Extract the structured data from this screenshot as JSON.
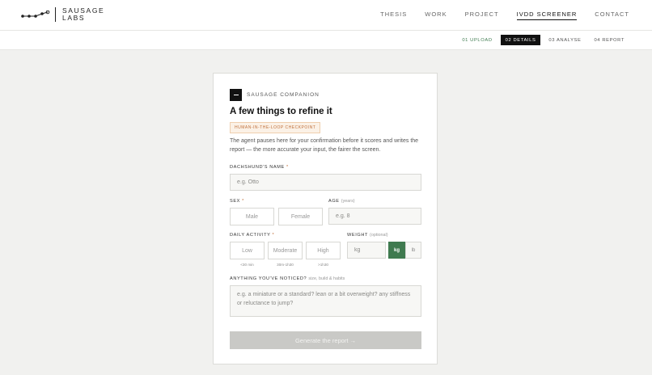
{
  "brand": {
    "line1": "SAUSAGE",
    "line2": "LABS"
  },
  "nav": [
    {
      "label": "THESIS"
    },
    {
      "label": "WORK"
    },
    {
      "label": "PROJECT"
    },
    {
      "label": "IVDD SCREENER",
      "active": true
    },
    {
      "label": "CONTACT"
    }
  ],
  "steps": [
    {
      "label": "01 UPLOAD",
      "state": "done"
    },
    {
      "label": "02 DETAILS",
      "state": "active"
    },
    {
      "label": "03 ANALYSE",
      "state": "todo"
    },
    {
      "label": "04 REPORT",
      "state": "todo"
    }
  ],
  "card": {
    "brand_label": "SAUSAGE COMPANION",
    "title": "A few things to refine it",
    "badge": "HUMAN-IN-THE-LOOP CHECKPOINT",
    "intro": "The agent pauses here for your confirmation before it scores and writes the report — the more accurate your input, the fairer the screen."
  },
  "form": {
    "name": {
      "label": "DACHSHUND'S NAME",
      "required_mark": "*",
      "placeholder": "e.g. Otto"
    },
    "sex": {
      "label": "SEX",
      "required_mark": "*",
      "options": [
        "Male",
        "Female"
      ]
    },
    "age": {
      "label": "AGE",
      "hint": "(years)",
      "placeholder": "e.g. 8"
    },
    "activity": {
      "label": "DAILY ACTIVITY",
      "required_mark": "*",
      "options": [
        {
          "label": "Low",
          "sub": "<30 min"
        },
        {
          "label": "Moderate",
          "sub": "30m-1h30"
        },
        {
          "label": "High",
          "sub": ">1h30"
        }
      ]
    },
    "weight": {
      "label": "WEIGHT",
      "hint": "(optional)",
      "placeholder": "kg",
      "units": [
        "kg",
        "lb"
      ],
      "selected_unit": "kg"
    },
    "notes": {
      "label": "ANYTHING YOU'VE NOTICED?",
      "hint": "size, build & habits",
      "placeholder": "e.g. a miniature or a standard? lean or a bit overweight? any stiffness or reluctance to jump?"
    },
    "submit_label": "Generate the report →"
  },
  "colors": {
    "accent_green": "#3f7a4f",
    "accent_orange": "#c0713d",
    "disabled_button": "#c9c9c6"
  }
}
